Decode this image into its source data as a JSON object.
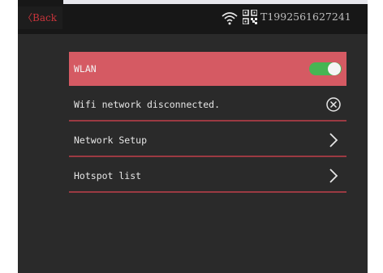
{
  "topbar": {
    "back_label": "〈Back",
    "serial": "T1992561627241",
    "wifi_icon": "wifi-icon",
    "qr_icon": "qr-code-icon"
  },
  "settings": {
    "wlan": {
      "label": "WLAN",
      "toggle_on": true,
      "accent": "#d55a63",
      "toggle_color": "#46b553"
    },
    "rows": [
      {
        "label": "Wifi network disconnected.",
        "icon": "close-circle-icon"
      },
      {
        "label": "Network Setup",
        "icon": "chevron-right-icon"
      },
      {
        "label": "Hotspot list",
        "icon": "chevron-right-icon"
      }
    ]
  },
  "colors": {
    "background": "#2a2a2a",
    "topbar": "#171717",
    "divider": "#9b3a42",
    "back_text": "#c9343b"
  }
}
